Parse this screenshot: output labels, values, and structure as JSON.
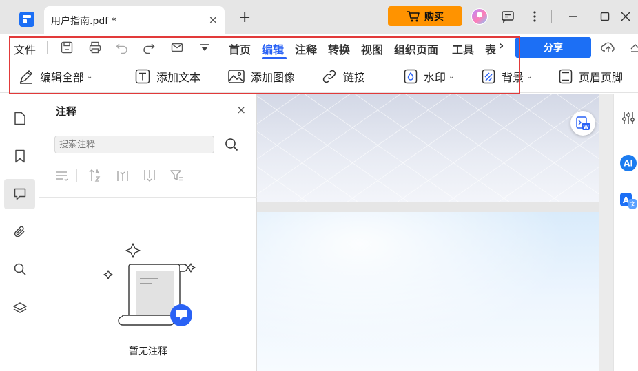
{
  "titlebar": {
    "tab_title": "用户指南.pdf *",
    "tab_close": "×",
    "new_tab": "+",
    "buy_label": "购买",
    "colors": {
      "buy": "#ff9300",
      "tab_bg": "#ffffff",
      "bar_bg": "#e6e6e6"
    }
  },
  "menu": {
    "file_label": "文件",
    "tabs": [
      {
        "label": "首页"
      },
      {
        "label": "编辑",
        "active": true
      },
      {
        "label": "注释"
      },
      {
        "label": "转换"
      },
      {
        "label": "视图"
      },
      {
        "label": "组织页面"
      },
      {
        "label": "工具"
      },
      {
        "label": "表"
      }
    ],
    "more_glyph": "›",
    "share_label": "分享",
    "accent": "#2a62f5"
  },
  "ribbon": {
    "edit_all": "编辑全部",
    "add_text": "添加文本",
    "add_image": "添加图像",
    "link": "链接",
    "watermark": "水印",
    "background": "背景",
    "header_footer": "页眉页脚",
    "caret": "⌄"
  },
  "panel": {
    "title": "注释",
    "close": "×",
    "search_placeholder": "搜索注释",
    "empty_text": "暂无注释"
  },
  "right_rail": {
    "ai_label": "AI",
    "translate_label": "A"
  },
  "icons": {
    "titlebar": [
      "app-logo-icon",
      "cart-icon",
      "avatar",
      "feedback-icon",
      "more-vertical-icon",
      "minimize-icon",
      "maximize-icon",
      "close-window-icon"
    ],
    "quick_access": [
      "save-icon",
      "print-icon",
      "undo-icon",
      "redo-icon",
      "mail-icon",
      "dropdown-icon"
    ],
    "ribbon": [
      "pen-icon",
      "text-icon",
      "image-icon",
      "link-icon",
      "watermark-icon",
      "background-icon",
      "header-footer-icon"
    ],
    "rail": [
      "page-icon",
      "bookmark-icon",
      "comment-icon",
      "attachment-icon",
      "search-icon",
      "layers-icon"
    ],
    "filters": [
      "sort-list-icon",
      "sort-az-icon",
      "filter-col-icon",
      "filter-col2-icon",
      "funnel-icon"
    ]
  }
}
